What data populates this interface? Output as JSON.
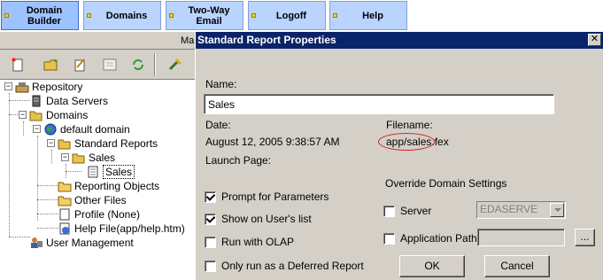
{
  "top_tabs": [
    {
      "label": "Domain\nBuilder",
      "active": true
    },
    {
      "label": "Domains",
      "active": false
    },
    {
      "label": "Two-Way\nEmail",
      "active": false
    },
    {
      "label": "Logoff",
      "active": false
    },
    {
      "label": "Help",
      "active": false
    }
  ],
  "left_panel": {
    "header_fragment": "Ma",
    "toolbar_icons": [
      "new-icon",
      "open-folder-icon",
      "edit-icon",
      "report-icon",
      "refresh-icon",
      "tools-icon"
    ],
    "tree": {
      "repository": "Repository",
      "data_servers": "Data Servers",
      "domains": "Domains",
      "default_domain": "default domain",
      "standard_reports": "Standard Reports",
      "sales_folder": "Sales",
      "sales_report": "Sales",
      "reporting_objects": "Reporting Objects",
      "other_files": "Other Files",
      "profile": "Profile (None)",
      "help_file": "Help File(app/help.htm)",
      "user_management": "User Management"
    }
  },
  "dialog": {
    "title": "Standard Report Properties",
    "close_label": "✕",
    "name_label": "Name:",
    "name_value": "Sales",
    "date_label": "Date:",
    "date_value": "August 12, 2005 9:38:57 AM",
    "filename_label": "Filename:",
    "filename_circled": "app/sales",
    "filename_rest": ".fex",
    "launch_page_label": "Launch Page:",
    "prompt_params": {
      "label": "Prompt for Parameters",
      "checked": true
    },
    "show_users_list": {
      "label": "Show on User's list",
      "checked": true
    },
    "run_olap": {
      "label": "Run with OLAP",
      "checked": false
    },
    "deferred": {
      "label": "Only run as a Deferred Report",
      "checked": false
    },
    "override_label": "Override Domain Settings",
    "server": {
      "label": "Server",
      "checked": false,
      "value": "EDASERVE"
    },
    "app_path": {
      "label": "Application Path",
      "checked": false,
      "value": ""
    },
    "browse_label": "...",
    "ok_label": "OK",
    "cancel_label": "Cancel"
  },
  "colors": {
    "title_bar": "#0a246a",
    "tab_fill": "#b9d4ff",
    "annotation_circle": "#d0202a"
  }
}
